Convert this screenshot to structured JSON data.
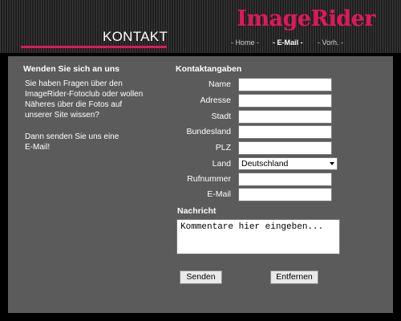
{
  "header": {
    "logo": "ImageRider",
    "page_title": "KONTAKT",
    "nav": [
      {
        "label": "- Home -",
        "active": false
      },
      {
        "label": "- E-Mail -",
        "active": true
      },
      {
        "label": "- Vorh. -",
        "active": false
      }
    ],
    "colors": {
      "brand": "#e0185a",
      "panel": "#5b5b5b",
      "background": "#000000"
    }
  },
  "left": {
    "heading": "Wenden Sie sich an uns",
    "intro_lines": [
      "Sie haben Fragen über den",
      "ImageRider-Fotoclub oder wollen",
      "Näheres über die Fotos auf",
      "unserer Site wissen?"
    ],
    "outro_lines": [
      "Dann senden Sie uns eine",
      "E-Mail!"
    ]
  },
  "form": {
    "heading": "Kontaktangaben",
    "fields": [
      {
        "label": "Name",
        "value": ""
      },
      {
        "label": "Adresse",
        "value": ""
      },
      {
        "label": "Stadt",
        "value": ""
      },
      {
        "label": "Bundesland",
        "value": ""
      },
      {
        "label": "PLZ",
        "value": ""
      }
    ],
    "country": {
      "label": "Land",
      "selected": "Deutschland"
    },
    "phone": {
      "label": "Rufnummer",
      "value": ""
    },
    "email": {
      "label": "E-Mail",
      "value": ""
    },
    "message": {
      "heading": "Nachricht",
      "value": "Kommentare hier eingeben..."
    },
    "buttons": {
      "send": "Senden",
      "clear": "Entfernen"
    }
  }
}
